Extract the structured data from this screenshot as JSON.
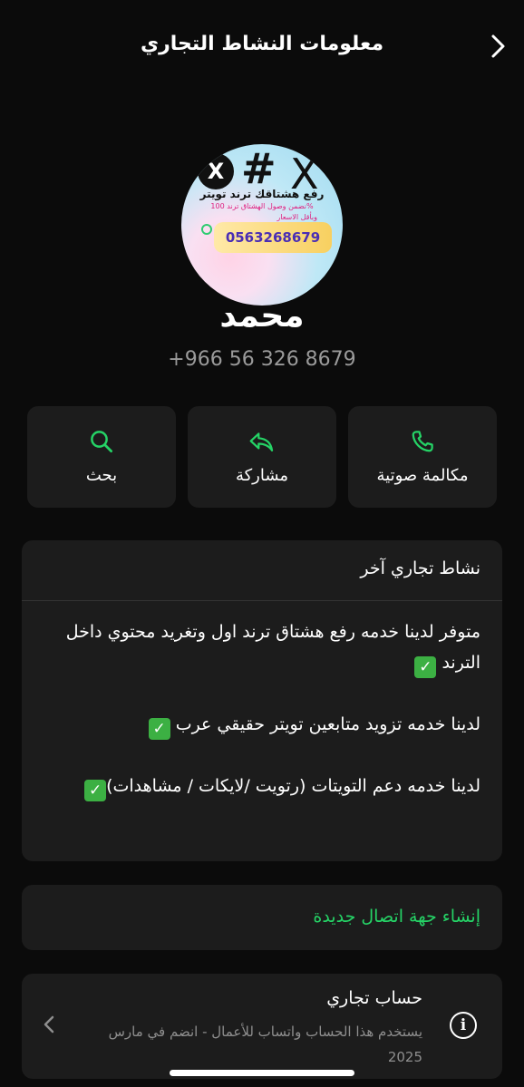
{
  "header": {
    "title": "معلومات النشاط التجاري"
  },
  "profile": {
    "name": "محمد",
    "phone": "+966 56 326 8679",
    "avatar": {
      "hash": "#",
      "x_logo": "X",
      "line1": "رفع هشتاقك ترند تويتر",
      "line2": "نضمن وصول الهشتاق ترند 100%",
      "line3": "وبأقل الاسعار",
      "phone_text": "0563268679"
    }
  },
  "actions": {
    "call": "مكالمة صوتية",
    "share": "مشاركة",
    "search": "بحث"
  },
  "business": {
    "category": "نشاط تجاري آخر",
    "desc_line1": "متوفر لدينا خدمه رفع هشتاق ترند اول  وتغريد محتوي داخل الترند",
    "desc_line2": "لدينا خدمه تزويد متابعين تويتر حقيقي عرب",
    "desc_line3": "لدينا خدمه دعم التويتات (رتويت /لايكات / مشاهدات)",
    "check": "✓"
  },
  "new_contact": {
    "label": "إنشاء جهة اتصال جديدة"
  },
  "business_account": {
    "title": "حساب تجاري",
    "subtitle": "يستخدم هذا الحساب واتساب للأعمال - انضم في مارس 2025"
  },
  "colors": {
    "accent": "#25d366",
    "card_bg": "#1c1c1c",
    "bg": "#0b0b0b"
  }
}
